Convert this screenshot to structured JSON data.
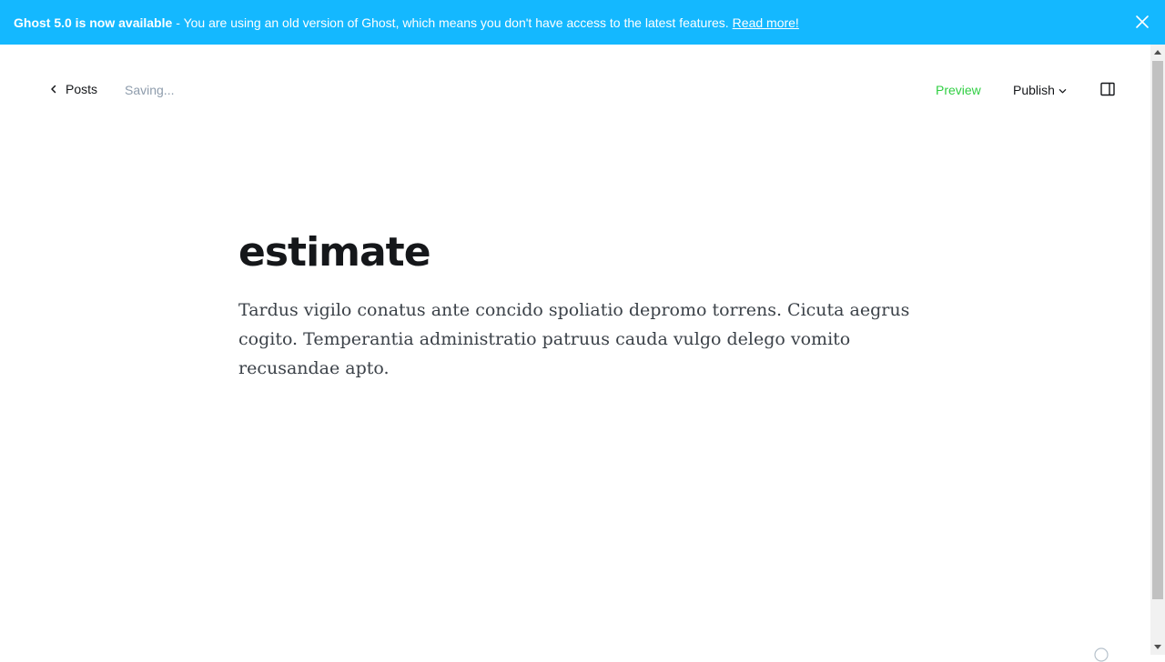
{
  "colors": {
    "banner_bg": "#14b8ff",
    "preview_green": "#30cf43",
    "text_dark": "#15171a",
    "muted": "#8e9cac"
  },
  "banner": {
    "strong": "Ghost 5.0 is now available",
    "message": "- You are using an old version of Ghost, which means you don't have access to the latest features.",
    "link": "Read more!",
    "close_icon": "close-icon"
  },
  "header": {
    "back_label": "Posts",
    "back_icon": "chevron-left-icon",
    "status": "Saving...",
    "preview_label": "Preview",
    "publish_label": "Publish",
    "publish_icon": "chevron-down-icon",
    "settings_icon": "sidebar-toggle-icon"
  },
  "post": {
    "title": "estimate",
    "body": "Tardus vigilo conatus ante concido spoliatio depromo torrens. Cicuta aegrus cogito. Temperantia administratio patruus cauda vulgo delego vomito recusandae apto."
  }
}
